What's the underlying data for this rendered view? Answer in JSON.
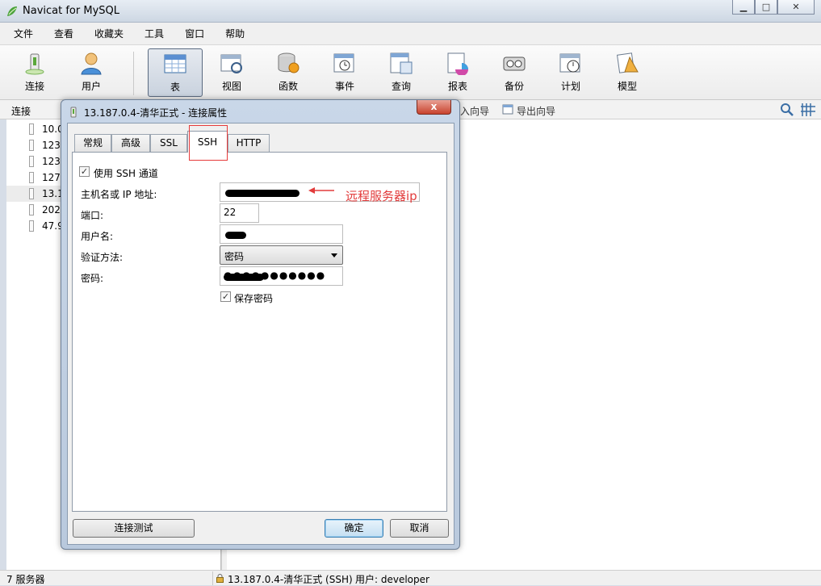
{
  "app": {
    "title": "Navicat for MySQL",
    "window_controls": [
      "minimize",
      "maximize",
      "close"
    ]
  },
  "menu": [
    "文件",
    "查看",
    "收藏夹",
    "工具",
    "窗口",
    "帮助"
  ],
  "toolbar": [
    {
      "label": "连接",
      "icon": "connect-icon"
    },
    {
      "label": "用户",
      "icon": "user-icon"
    },
    {
      "label": "表",
      "icon": "table-icon",
      "active": true
    },
    {
      "label": "视图",
      "icon": "view-icon"
    },
    {
      "label": "函数",
      "icon": "function-icon"
    },
    {
      "label": "事件",
      "icon": "event-icon"
    },
    {
      "label": "查询",
      "icon": "query-icon"
    },
    {
      "label": "报表",
      "icon": "report-icon"
    },
    {
      "label": "备份",
      "icon": "backup-icon"
    },
    {
      "label": "计划",
      "icon": "schedule-icon"
    },
    {
      "label": "模型",
      "icon": "model-icon"
    }
  ],
  "subbar": {
    "connections_label": "连接",
    "import_wizard": "导入向导",
    "export_wizard": "导出向导"
  },
  "tree": [
    {
      "label": "10.0"
    },
    {
      "label": "123"
    },
    {
      "label": "123"
    },
    {
      "label": "127"
    },
    {
      "label": "13.1",
      "selected": true
    },
    {
      "label": "202"
    },
    {
      "label": "47.9"
    }
  ],
  "status": {
    "servers": "7 服务器",
    "connection": "13.187.0.4-清华正式 (SSH)",
    "user": "用户: developer"
  },
  "dialog": {
    "title": "13.187.0.4-清华正式 - 连接属性",
    "close_label": "x",
    "tabs": [
      "常规",
      "高级",
      "SSL",
      "SSH",
      "HTTP"
    ],
    "active_tab": "SSH",
    "use_ssh": {
      "label": "使用 SSH 通道",
      "checked": true
    },
    "host_label": "主机名或 IP 地址:",
    "host_value": "",
    "port_label": "端口:",
    "port_value": "22",
    "username_label": "用户名:",
    "username_value": "",
    "auth_label": "验证方法:",
    "auth_value": "密码",
    "password_label": "密码:",
    "password_value": "●●●●●●●●●●●",
    "save_password": {
      "label": "保存密码",
      "checked": true
    },
    "test_button": "连接测试",
    "ok_button": "确定",
    "cancel_button": "取消"
  },
  "annotation": {
    "text": "远程服务器ip",
    "color": "#e23b3b"
  }
}
